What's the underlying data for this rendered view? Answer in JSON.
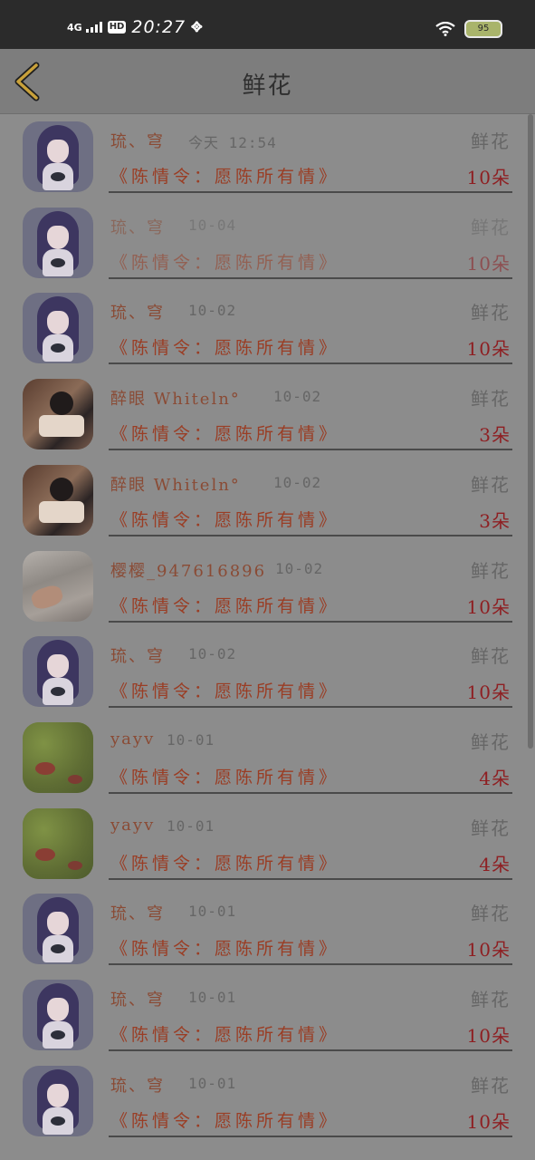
{
  "status_bar": {
    "network": "4G",
    "hd": "HD",
    "time": "20:27",
    "extra_icon_text": "᪣",
    "battery": "95"
  },
  "header": {
    "back_icon": "chevron-left-icon",
    "title": "鲜花"
  },
  "rows": [
    {
      "avatar": "anime-girl",
      "name": "琉、穹",
      "date": "今天 12:54",
      "label": "鲜花",
      "book": "《陈情令：愿陈所有情》",
      "count": "10朵",
      "faded": false
    },
    {
      "avatar": "anime-girl",
      "name": "琉、穹",
      "date": "10-04",
      "label": "鲜花",
      "book": "《陈情令：愿陈所有情》",
      "count": "10朵",
      "faded": true
    },
    {
      "avatar": "anime-girl",
      "name": "琉、穹",
      "date": "10-02",
      "label": "鲜花",
      "book": "《陈情令：愿陈所有情》",
      "count": "10朵",
      "faded": false
    },
    {
      "avatar": "photo",
      "name": "醉眼 Whiteln°",
      "date": "10-02",
      "label": "鲜花",
      "book": "《陈情令：愿陈所有情》",
      "count": "3朵",
      "faded": false
    },
    {
      "avatar": "photo",
      "name": "醉眼 Whiteln°",
      "date": "10-02",
      "label": "鲜花",
      "book": "《陈情令：愿陈所有情》",
      "count": "3朵",
      "faded": false
    },
    {
      "avatar": "sketch",
      "name": "樱樱_947616896",
      "date": "10-02",
      "label": "鲜花",
      "book": "《陈情令：愿陈所有情》",
      "count": "10朵",
      "faded": false
    },
    {
      "avatar": "anime-girl",
      "name": "琉、穹",
      "date": "10-02",
      "label": "鲜花",
      "book": "《陈情令：愿陈所有情》",
      "count": "10朵",
      "faded": false
    },
    {
      "avatar": "green",
      "name": "yayv",
      "date": "10-01",
      "label": "鲜花",
      "book": "《陈情令：愿陈所有情》",
      "count": "4朵",
      "faded": false
    },
    {
      "avatar": "green",
      "name": "yayv",
      "date": "10-01",
      "label": "鲜花",
      "book": "《陈情令：愿陈所有情》",
      "count": "4朵",
      "faded": false
    },
    {
      "avatar": "anime-girl",
      "name": "琉、穹",
      "date": "10-01",
      "label": "鲜花",
      "book": "《陈情令：愿陈所有情》",
      "count": "10朵",
      "faded": false
    },
    {
      "avatar": "anime-girl",
      "name": "琉、穹",
      "date": "10-01",
      "label": "鲜花",
      "book": "《陈情令：愿陈所有情》",
      "count": "10朵",
      "faded": false
    },
    {
      "avatar": "anime-girl",
      "name": "琉、穹",
      "date": "10-01",
      "label": "鲜花",
      "book": "《陈情令：愿陈所有情》",
      "count": "10朵",
      "faded": false
    }
  ],
  "colors": {
    "background": "#8c8c8c",
    "status_bar": "#2b2b2b",
    "name_text": "#8a4b35",
    "book_text": "#9a3d24",
    "count_text": "#8e1f22",
    "back_chevron": "#c9a13a"
  }
}
